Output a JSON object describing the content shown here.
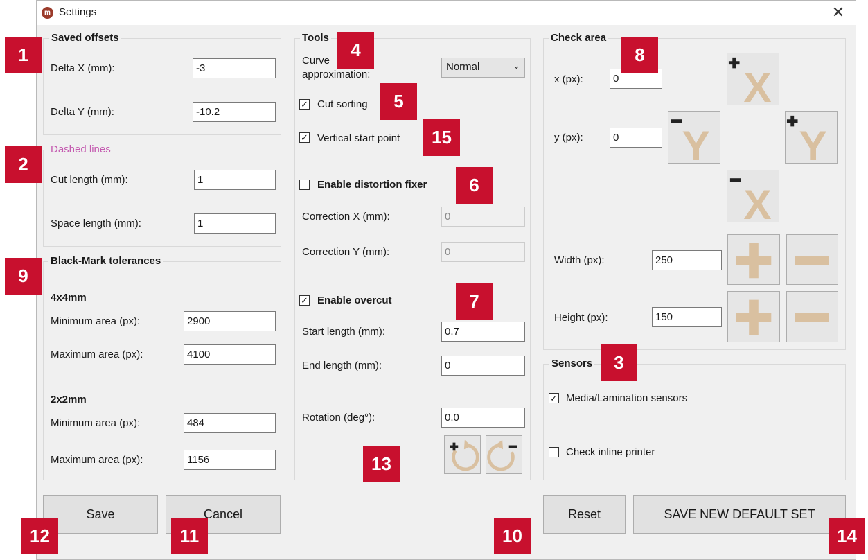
{
  "window": {
    "title": "Settings",
    "app_icon": "app-logo-icon",
    "close_label": "✕"
  },
  "saved_offsets": {
    "title": "Saved offsets",
    "delta_x_label": "Delta X (mm):",
    "delta_x_value": "-3",
    "delta_y_label": "Delta Y (mm):",
    "delta_y_value": "-10.2"
  },
  "dashed_lines": {
    "title": "Dashed lines",
    "cut_length_label": "Cut length (mm):",
    "cut_length_value": "1",
    "space_length_label": "Space length (mm):",
    "space_length_value": "1"
  },
  "black_mark": {
    "title": "Black-Mark tolerances",
    "group1": {
      "title": "4x4mm",
      "min_label": "Minimum area (px):",
      "min_value": "2900",
      "max_label": "Maximum area (px):",
      "max_value": "4100"
    },
    "group2": {
      "title": "2x2mm",
      "min_label": "Minimum area (px):",
      "min_value": "484",
      "max_label": "Maximum area (px):",
      "max_value": "1156"
    }
  },
  "tools": {
    "title": "Tools",
    "curve_label_1": "Curve",
    "curve_label_2": "approximation:",
    "curve_value": "Normal",
    "cut_sorting_label": "Cut sorting",
    "cut_sorting_checked": true,
    "vertical_start_label": "Vertical start point",
    "vertical_start_checked": true,
    "distortion_label": "Enable distortion fixer",
    "distortion_checked": false,
    "correction_x_label": "Correction X (mm):",
    "correction_x_value": "0",
    "correction_y_label": "Correction Y (mm):",
    "correction_y_value": "0",
    "overcut_label": "Enable overcut",
    "overcut_checked": true,
    "start_length_label": "Start length (mm):",
    "start_length_value": "0.7",
    "end_length_label": "End length (mm):",
    "end_length_value": "0",
    "rotation_label": "Rotation (deg°):",
    "rotation_value": "0.0"
  },
  "check_area": {
    "title": "Check area",
    "x_label": "x (px):",
    "x_value": "0",
    "y_label": "y (px):",
    "y_value": "0",
    "width_label": "Width (px):",
    "width_value": "250",
    "height_label": "Height (px):",
    "height_value": "150",
    "accent_color": "#d9c0a0"
  },
  "sensors": {
    "title": "Sensors",
    "media_label": "Media/Lamination sensors",
    "media_checked": true,
    "inline_label": "Check inline printer",
    "inline_checked": false
  },
  "buttons": {
    "save": "Save",
    "cancel": "Cancel",
    "reset": "Reset",
    "save_default": "SAVE NEW DEFAULT SET"
  },
  "badges": {
    "b1": "1",
    "b2": "2",
    "b3": "3",
    "b4": "4",
    "b5": "5",
    "b6": "6",
    "b7": "7",
    "b8": "8",
    "b9": "9",
    "b10": "10",
    "b11": "11",
    "b12": "12",
    "b13": "13",
    "b14": "14",
    "b15": "15",
    "color": "#c8102e"
  }
}
